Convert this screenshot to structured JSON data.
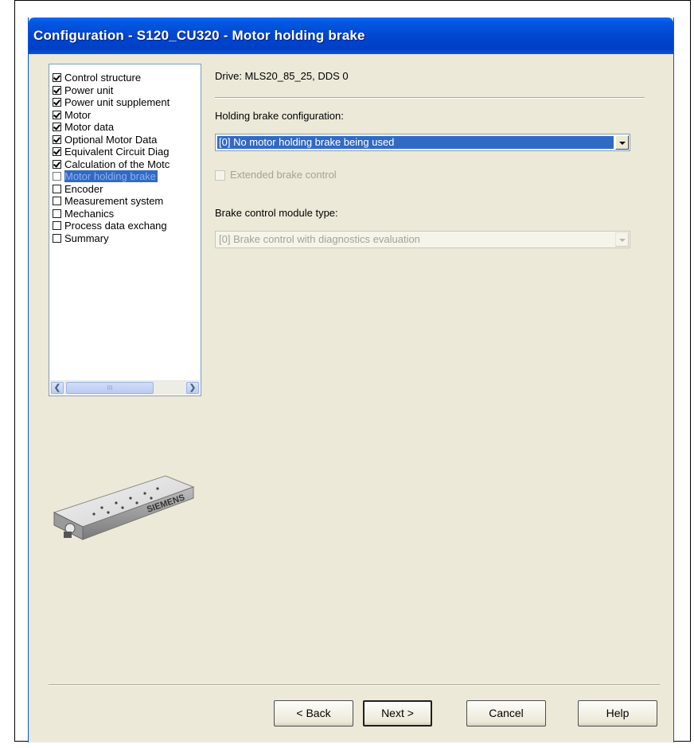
{
  "window": {
    "title": "Configuration - S120_CU320 - Motor holding brake"
  },
  "nav": {
    "items": [
      {
        "label": "Control structure",
        "checked": true,
        "selected": false
      },
      {
        "label": "Power unit",
        "checked": true,
        "selected": false
      },
      {
        "label": "Power unit supplement",
        "checked": true,
        "selected": false
      },
      {
        "label": "Motor",
        "checked": true,
        "selected": false
      },
      {
        "label": "Motor data",
        "checked": true,
        "selected": false
      },
      {
        "label": "Optional Motor Data",
        "checked": true,
        "selected": false
      },
      {
        "label": "Equivalent Circuit Diag",
        "checked": true,
        "selected": false
      },
      {
        "label": "Calculation of the Motc",
        "checked": true,
        "selected": false
      },
      {
        "label": "Motor holding brake",
        "checked": false,
        "selected": true
      },
      {
        "label": "Encoder",
        "checked": false,
        "selected": false
      },
      {
        "label": "Measurement system",
        "checked": false,
        "selected": false
      },
      {
        "label": "Mechanics",
        "checked": false,
        "selected": false
      },
      {
        "label": "Process data exchang",
        "checked": false,
        "selected": false
      },
      {
        "label": "Summary",
        "checked": false,
        "selected": false
      }
    ],
    "scroll_thumb_label": "III"
  },
  "main": {
    "drive_label": "Drive: MLS20_85_25, DDS 0",
    "holding_brake_label": "Holding brake configuration:",
    "holding_brake_value": "[0] No motor holding brake being used",
    "extended_brake_label": "Extended brake control",
    "brake_module_label": "Brake control module type:",
    "brake_module_value": "[0] Brake control with diagnostics evaluation"
  },
  "image": {
    "brand": "SIEMENS"
  },
  "buttons": {
    "back": "< Back",
    "next": "Next >",
    "cancel": "Cancel",
    "help": "Help"
  },
  "colors": {
    "title_bar": "#0147d0",
    "selection": "#316ac5",
    "dialog_bg": "#ece9d8"
  }
}
